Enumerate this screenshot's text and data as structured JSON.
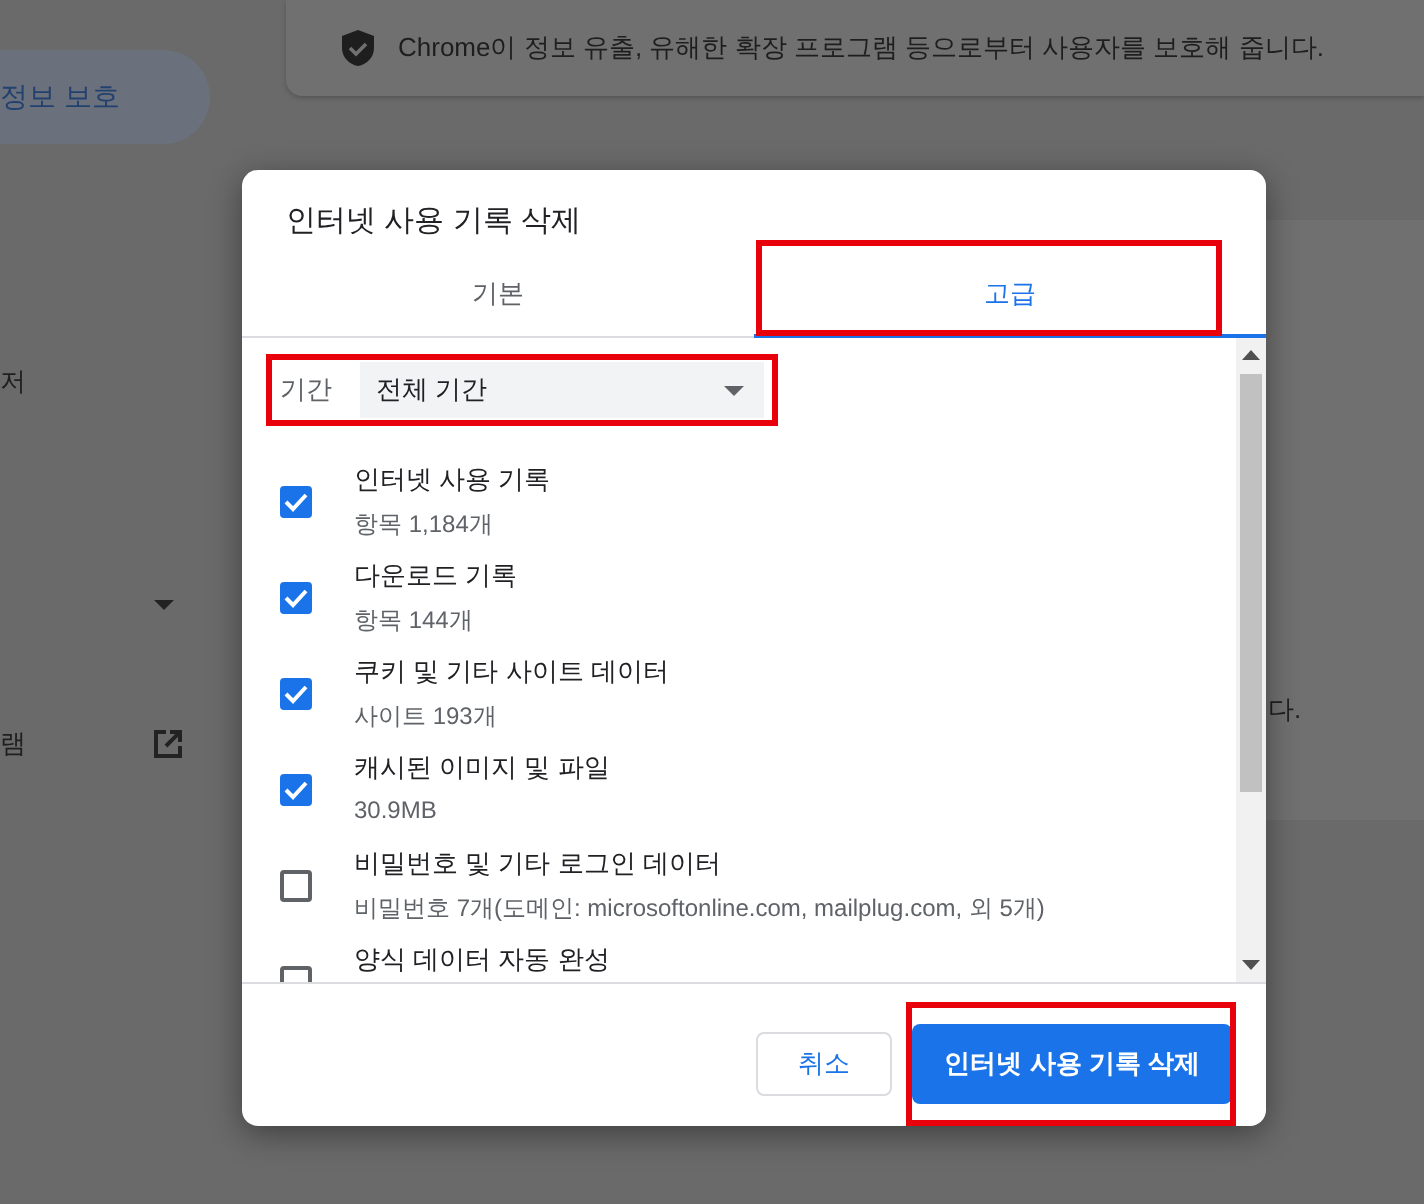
{
  "background": {
    "notice": "Chrome이 정보 유출, 유해한 확장 프로그램 등으로부터 사용자를 보호해 줍니다.",
    "sidebar": [
      {
        "label": "정보 보호",
        "selected": true
      }
    ],
    "fragments": [
      "저",
      "램",
      "다."
    ]
  },
  "dialog": {
    "title": "인터넷 사용 기록 삭제",
    "tabs": [
      {
        "label": "기본",
        "selected": false,
        "highlighted": false
      },
      {
        "label": "고급",
        "selected": true,
        "highlighted": true
      }
    ],
    "period": {
      "label": "기간",
      "value": "전체 기간",
      "highlighted": true
    },
    "items": [
      {
        "title": "인터넷 사용 기록",
        "detail": "항목 1,184개",
        "checked": true
      },
      {
        "title": "다운로드 기록",
        "detail": "항목 144개",
        "checked": true
      },
      {
        "title": "쿠키 및 기타 사이트 데이터",
        "detail": "사이트 193개",
        "checked": true
      },
      {
        "title": "캐시된 이미지 및 파일",
        "detail": "30.9MB",
        "checked": true
      },
      {
        "title": "비밀번호 및 기타 로그인 데이터",
        "detail": "비밀번호 7개(도메인: microsoftonline.com, mailplug.com, 외 5개)",
        "checked": false
      },
      {
        "title": "양식 데이터 자동 완성",
        "checked": false
      }
    ],
    "buttons": [
      {
        "label": "취소",
        "kind": "secondary",
        "highlighted": false
      },
      {
        "label": "인터넷 사용 기록 삭제",
        "kind": "primary",
        "highlighted": true
      }
    ]
  }
}
